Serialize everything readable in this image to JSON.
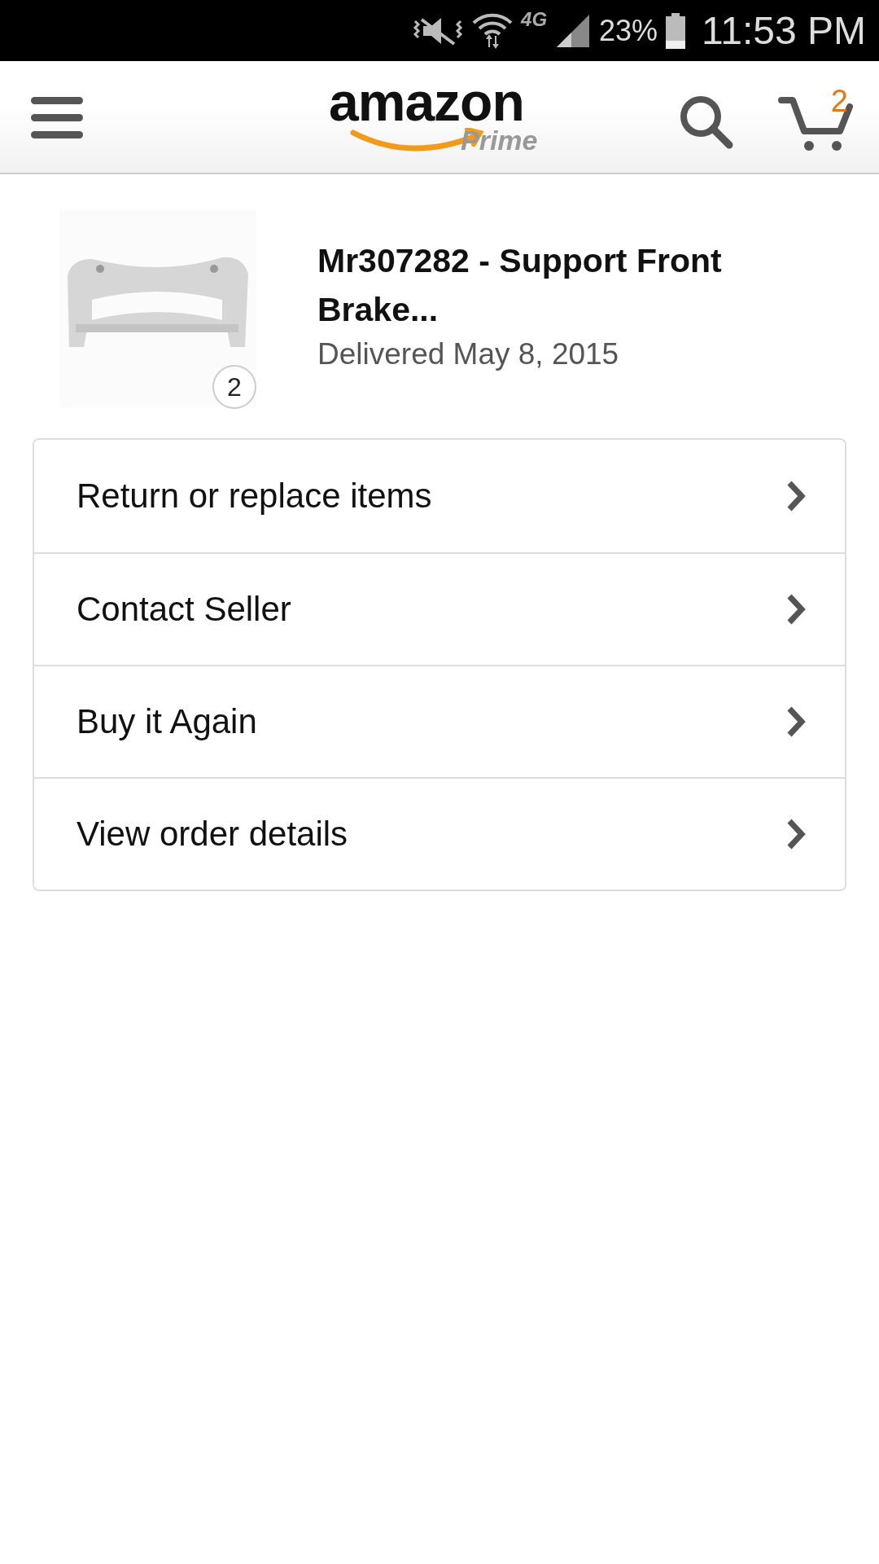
{
  "status_bar": {
    "network": "4G",
    "battery_percent": "23%",
    "time": "11:53 PM"
  },
  "header": {
    "logo": "amazon",
    "logo_sub": "Prime",
    "cart_count": "2"
  },
  "order": {
    "quantity": "2",
    "title": "Mr307282 - Support Front Brake...",
    "delivered": "Delivered May 8, 2015"
  },
  "actions": [
    {
      "label": "Return or replace items"
    },
    {
      "label": "Contact Seller"
    },
    {
      "label": "Buy it Again"
    },
    {
      "label": "View order details"
    }
  ]
}
